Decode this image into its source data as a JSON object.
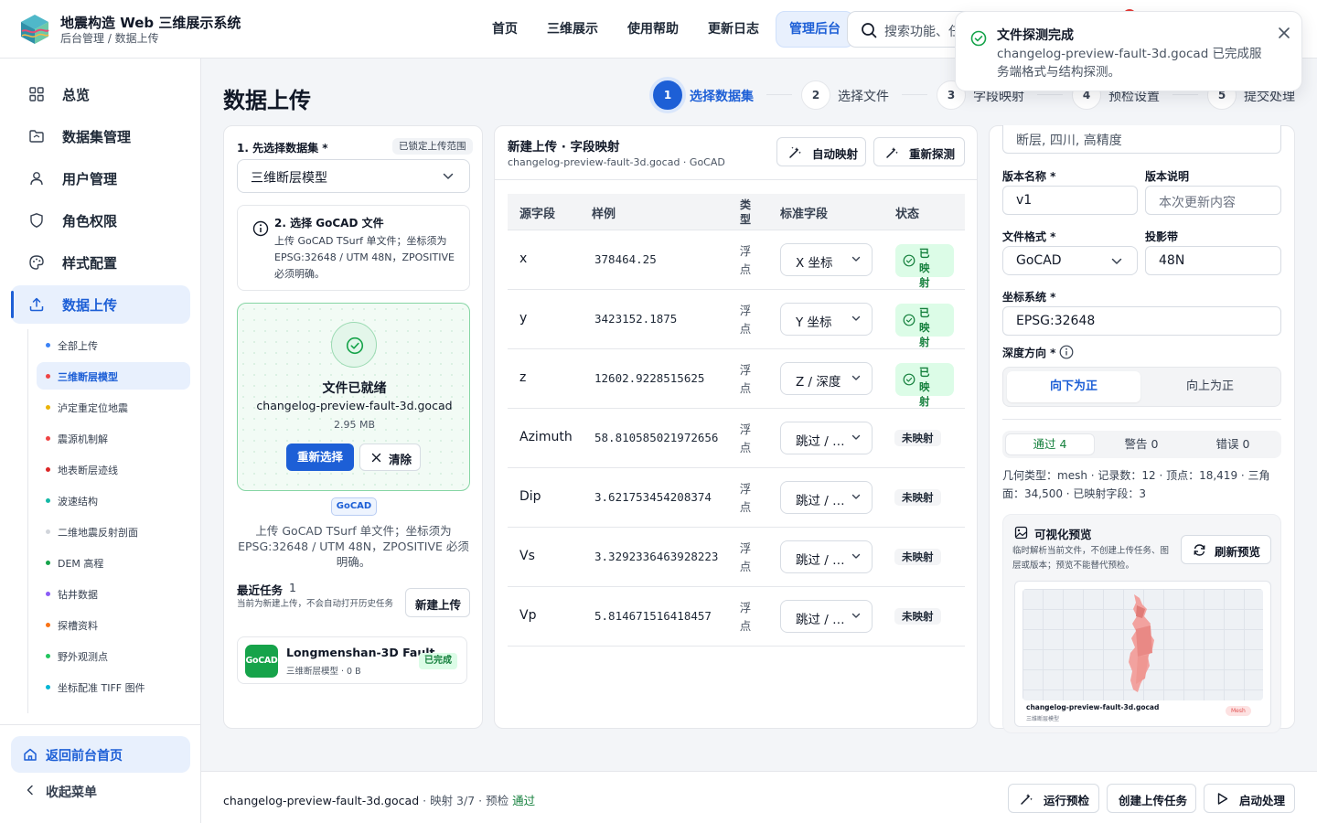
{
  "app": {
    "title": "地震构造 Web 三维展示系统",
    "breadcrumb": "后台管理 / 数据上传"
  },
  "nav": [
    "首页",
    "三维展示",
    "使用帮助",
    "更新日志",
    "管理后台"
  ],
  "search": {
    "placeholder": "搜索功能、任务"
  },
  "toast": {
    "title": "文件探测完成",
    "message": "changelog-preview-fault-3d.gocad 已完成服务端格式与结构探测。"
  },
  "sidebar": {
    "items": [
      "总览",
      "数据集管理",
      "用户管理",
      "角色权限",
      "样式配置",
      "数据上传"
    ],
    "subitems": [
      {
        "label": "全部上传",
        "color": "#3b82f6"
      },
      {
        "label": "三维断层模型",
        "color": "#ef4444"
      },
      {
        "label": "泸定重定位地震",
        "color": "#eab308"
      },
      {
        "label": "震源机制解",
        "color": "#ef4444"
      },
      {
        "label": "地表断层迹线",
        "color": "#dc2626"
      },
      {
        "label": "波速结构",
        "color": "#14b8a6"
      },
      {
        "label": "二维地震反射剖面",
        "color": "#d1d5db"
      },
      {
        "label": "DEM 高程",
        "color": "#16a34a"
      },
      {
        "label": "钻井数据",
        "color": "#8b5cf6"
      },
      {
        "label": "探槽资料",
        "color": "#f97316"
      },
      {
        "label": "野外观测点",
        "color": "#22c55e"
      },
      {
        "label": "坐标配准 TIFF 图件",
        "color": "#06b6d4"
      }
    ],
    "home": "返回前台首页",
    "collapse": "收起菜单"
  },
  "page": {
    "title": "数据上传"
  },
  "steps": [
    {
      "num": "1",
      "label": "选择数据集"
    },
    {
      "num": "2",
      "label": "选择文件"
    },
    {
      "num": "3",
      "label": "字段映射"
    },
    {
      "num": "4",
      "label": "预检设置"
    },
    {
      "num": "5",
      "label": "提交处理"
    }
  ],
  "left": {
    "section1": "1. 先选择数据集 *",
    "lock_tag": "已锁定上传范围",
    "dataset": "三维断层模型",
    "info_title": "2. 选择 GoCAD 文件",
    "info_desc": "上传 GoCAD TSurf 单文件；坐标须为 EPSG:32648 / UTM 48N，ZPOSITIVE 必须明确。",
    "file_title": "文件已就绪",
    "file_name": "changelog-preview-fault-3d.gocad",
    "file_size": "2.95 MB",
    "reselect": "重新选择",
    "clear": "清除",
    "format_tag": "GoCAD",
    "hint": "上传 GoCAD TSurf 单文件；坐标须为 EPSG:32648 / UTM 48N，ZPOSITIVE 必须明确。",
    "recent_title": "最近任务",
    "recent_count": "1",
    "recent_desc": "当前为新建上传，不会自动打开历史任务",
    "new_upload": "新建上传",
    "task": {
      "icon": "GoCAD",
      "name": "Longmenshan-3D Fault",
      "sub": "三维断层模型 · 0 B",
      "status": "已完成"
    }
  },
  "mapping": {
    "title": "新建上传 · 字段映射",
    "subtitle": "changelog-preview-fault-3d.gocad · GoCAD",
    "auto_btn": "自动映射",
    "redetect_btn": "重新探测",
    "headers": [
      "源字段",
      "样例",
      "类型",
      "标准字段",
      "状态"
    ],
    "rows": [
      {
        "src": "x",
        "example": "378464.25",
        "type": "浮点",
        "target": "X 坐标",
        "status": "已映射",
        "mapped": true
      },
      {
        "src": "y",
        "example": "3423152.1875",
        "type": "浮点",
        "target": "Y 坐标",
        "status": "已映射",
        "mapped": true
      },
      {
        "src": "z",
        "example": "12602.9228515625",
        "type": "浮点",
        "target": "Z / 深度",
        "status": "已映射",
        "mapped": true
      },
      {
        "src": "Azimuth",
        "example": "58.810585021972656",
        "type": "浮点",
        "target": "跳过 / 不导入",
        "status": "未映射",
        "mapped": false
      },
      {
        "src": "Dip",
        "example": "3.621753454208374",
        "type": "浮点",
        "target": "跳过 / 不导入",
        "status": "未映射",
        "mapped": false
      },
      {
        "src": "Vs",
        "example": "3.3292336463928223",
        "type": "浮点",
        "target": "跳过 / 不导入",
        "status": "未映射",
        "mapped": false
      },
      {
        "src": "Vp",
        "example": "5.814671516418457",
        "type": "浮点",
        "target": "跳过 / 不导入",
        "status": "未映射",
        "mapped": false
      }
    ]
  },
  "right": {
    "tags_value": "断层, 四川, 高精度",
    "version_label": "版本名称 *",
    "version_value": "v1",
    "version_desc_label": "版本说明",
    "version_desc_placeholder": "本次更新内容",
    "format_label": "文件格式 *",
    "format_value": "GoCAD",
    "zone_label": "投影带",
    "zone_value": "48N",
    "crs_label": "坐标系统 *",
    "crs_value": "EPSG:32648",
    "depth_label": "深度方向 *",
    "depth_options": [
      "向下为正",
      "向上为正"
    ],
    "check_tabs": [
      "通过 4",
      "警告 0",
      "错误 0"
    ],
    "stats": "几何类型：mesh · 记录数：12 · 顶点：18,419 · 三角面：34,500 · 已映射字段：3",
    "preview_title": "可视化预览",
    "preview_desc": "临时解析当前文件，不创建上传任务、图层或版本；预览不能替代预检。",
    "refresh_btn": "刷新预览",
    "preview_file": "changelog-preview-fault-3d.gocad",
    "preview_category": "三维断层模型",
    "preview_geom": "Mesh"
  },
  "footer": {
    "file": "changelog-preview-fault-3d.gocad",
    "mapping": "映射 3/7",
    "precheck_label": "预检",
    "precheck_value": "通过",
    "run_precheck": "运行预检",
    "create_task": "创建上传任务",
    "start": "启动处理"
  },
  "colors": {
    "primary": "#1d5fd6",
    "success": "#15803d",
    "success_bg": "#dcfce7",
    "danger": "#e53935"
  }
}
